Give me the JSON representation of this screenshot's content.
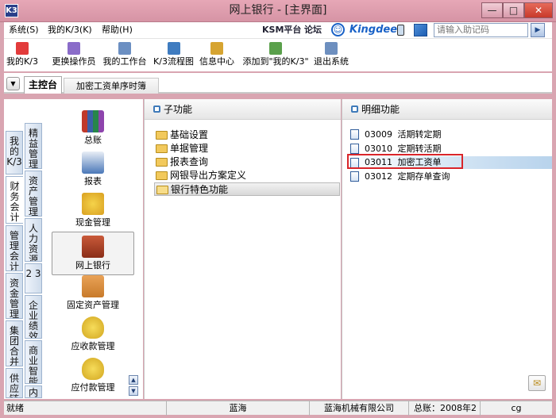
{
  "window": {
    "app_icon_text": "K3",
    "title": "网上银行 - [主界面]",
    "min_label": "—",
    "max_label": "□",
    "close_label": "✕"
  },
  "menu": {
    "items": [
      "系统(S)",
      "我的K/3(K)",
      "帮助(H)"
    ],
    "ksm": "KSM平台",
    "forum": "论坛",
    "brand": "Kingdee",
    "helpcode_placeholder": "请输入助记码",
    "go_label": "▶"
  },
  "toolbar": {
    "items": [
      {
        "label": "我的K/3",
        "icon": "star-icon",
        "color": "#e23b3b"
      },
      {
        "label": "更换操作员",
        "icon": "users-icon",
        "color": "#8a6cc9"
      },
      {
        "label": "我的工作台",
        "icon": "pencil-icon",
        "color": "#6b8fc2"
      },
      {
        "label": "K/3流程图",
        "icon": "flowchart-icon",
        "color": "#3f7cc0"
      },
      {
        "label": "信息中心",
        "icon": "chat-icon",
        "color": "#d6a431"
      },
      {
        "label": "添加到\"我的K/3\"",
        "icon": "add-fav-icon",
        "color": "#5aa04b"
      },
      {
        "label": "退出系统",
        "icon": "exit-icon",
        "color": "#6d8fbf"
      }
    ]
  },
  "tabs": {
    "dropdown_label": "▼",
    "main": "主控台",
    "second": "加密工资单序时簿"
  },
  "vtabs_col1": [
    "我的K/3",
    "财务会计",
    "管理会计",
    "资金管理",
    "集团合并",
    "供应链"
  ],
  "vtabs_col2": [
    "精益管理",
    "资产管理",
    "人力资源",
    "2 3",
    "企业绩效",
    "商业智能",
    "内"
  ],
  "modules": [
    {
      "label": "总账",
      "icon": "books-icon",
      "color": "#3b5fa7"
    },
    {
      "label": "报表",
      "icon": "report-icon",
      "color": "#4a78b8"
    },
    {
      "label": "现金管理",
      "icon": "cash-icon",
      "color": "#d9a021"
    },
    {
      "label": "网上银行",
      "icon": "bank-icon",
      "color": "#b9472b"
    },
    {
      "label": "固定资产管理",
      "icon": "truck-icon",
      "color": "#c87a2a"
    },
    {
      "label": "应收款管理",
      "icon": "moneybag-in-icon",
      "color": "#d2a620"
    },
    {
      "label": "应付款管理",
      "icon": "moneybag-out-icon",
      "color": "#d2a620"
    }
  ],
  "subfunctions": {
    "header": "子功能",
    "items": [
      "基础设置",
      "单据管理",
      "报表查询",
      "网银导出方案定义",
      "银行特色功能"
    ],
    "selected": "银行特色功能"
  },
  "details": {
    "header": "明细功能",
    "items": [
      {
        "code": "03009",
        "name": "活期转定期"
      },
      {
        "code": "03010",
        "name": "定期转活期"
      },
      {
        "code": "03011",
        "name": "加密工资单"
      },
      {
        "code": "03012",
        "name": "定期存单查询"
      }
    ],
    "selected": "03011"
  },
  "status": {
    "ready": "就绪",
    "user": "蓝海",
    "company": "蓝海机械有限公司",
    "period": "总账：2008年2期",
    "extra": "cg"
  }
}
